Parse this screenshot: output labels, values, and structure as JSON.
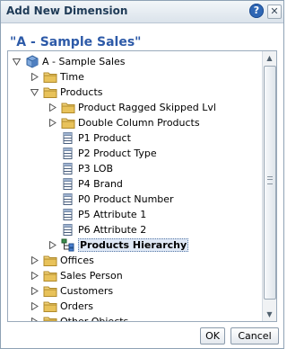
{
  "dialog": {
    "title": "Add New Dimension",
    "help_icon_glyph": "?",
    "close_icon_glyph": "✕",
    "subject_area_title": "\"A - Sample Sales\""
  },
  "tree": {
    "items": [
      {
        "label": "A - Sample Sales",
        "toggle": "expanded",
        "icon": "cube-icon"
      },
      {
        "label": "Time",
        "toggle": "collapsed",
        "icon": "folder-icon"
      },
      {
        "label": "Products",
        "toggle": "expanded",
        "icon": "folder-icon"
      },
      {
        "label": "Product Ragged Skipped Lvl",
        "toggle": "collapsed",
        "icon": "folder-icon"
      },
      {
        "label": "Double Column Products",
        "toggle": "collapsed",
        "icon": "folder-icon"
      },
      {
        "label": "P1 Product",
        "toggle": "none",
        "icon": "column-icon"
      },
      {
        "label": "P2 Product Type",
        "toggle": "none",
        "icon": "column-icon"
      },
      {
        "label": "P3 LOB",
        "toggle": "none",
        "icon": "column-icon"
      },
      {
        "label": "P4 Brand",
        "toggle": "none",
        "icon": "column-icon"
      },
      {
        "label": "P0 Product Number",
        "toggle": "none",
        "icon": "column-icon"
      },
      {
        "label": "P5 Attribute 1",
        "toggle": "none",
        "icon": "column-icon"
      },
      {
        "label": "P6 Attribute 2",
        "toggle": "none",
        "icon": "column-icon"
      },
      {
        "label": "Products Hierarchy",
        "toggle": "collapsed",
        "icon": "hierarchy-icon",
        "selected": true
      },
      {
        "label": "Offices",
        "toggle": "collapsed",
        "icon": "folder-icon"
      },
      {
        "label": "Sales Person",
        "toggle": "collapsed",
        "icon": "folder-icon"
      },
      {
        "label": "Customers",
        "toggle": "collapsed",
        "icon": "folder-icon"
      },
      {
        "label": "Orders",
        "toggle": "collapsed",
        "icon": "folder-icon"
      },
      {
        "label": "Other Objects",
        "toggle": "collapsed",
        "icon": "folder-icon"
      }
    ]
  },
  "buttons": {
    "ok_label": "OK",
    "cancel_label": "Cancel"
  },
  "colors": {
    "accent": "#2d5aa8",
    "folder": "#e8c25a",
    "selection": "#dfe8f5"
  }
}
